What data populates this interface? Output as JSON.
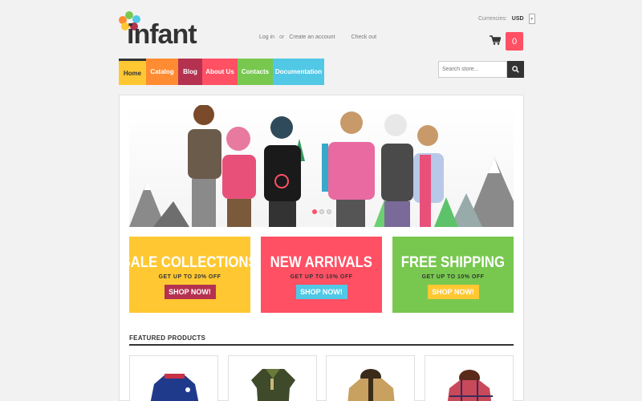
{
  "logo": {
    "text": "infant"
  },
  "top_links": {
    "login": "Log in",
    "or": "or",
    "create": "Create an account",
    "checkout": "Check out"
  },
  "currency": {
    "label": "Currencies:",
    "value": "USD"
  },
  "cart": {
    "count": "0",
    "icon": "cart-icon"
  },
  "nav": [
    {
      "label": "Home",
      "color": "#ffc832"
    },
    {
      "label": "Catalog",
      "color": "#ff8c32"
    },
    {
      "label": "Blog",
      "color": "#b43250"
    },
    {
      "label": "About Us",
      "color": "#ff5064"
    },
    {
      "label": "Contacts",
      "color": "#78c850"
    },
    {
      "label": "Documentation",
      "color": "#50c8e6"
    }
  ],
  "search": {
    "placeholder": "Search store...",
    "icon": "search-icon"
  },
  "slider": {
    "active_slide": 1,
    "slide_count": 3
  },
  "banners": [
    {
      "title": "SALE COLLECTIONS",
      "subtitle": "GET UP TO 20% OFF",
      "button": "SHOP NOW!",
      "bg": "#ffc832",
      "button_bg": "#b43250"
    },
    {
      "title": "NEW ARRIVALS",
      "subtitle": "GET UP TO 10% OFF",
      "button": "SHOP NOW!",
      "bg": "#ff5064",
      "button_bg": "#50c8e6"
    },
    {
      "title": "FREE SHIPPING",
      "subtitle": "GET UP TO 10% OFF",
      "button": "SHOP NOW!",
      "bg": "#78c850",
      "button_bg": "#ffc832"
    }
  ],
  "featured": {
    "heading": "FEATURED PRODUCTS"
  }
}
